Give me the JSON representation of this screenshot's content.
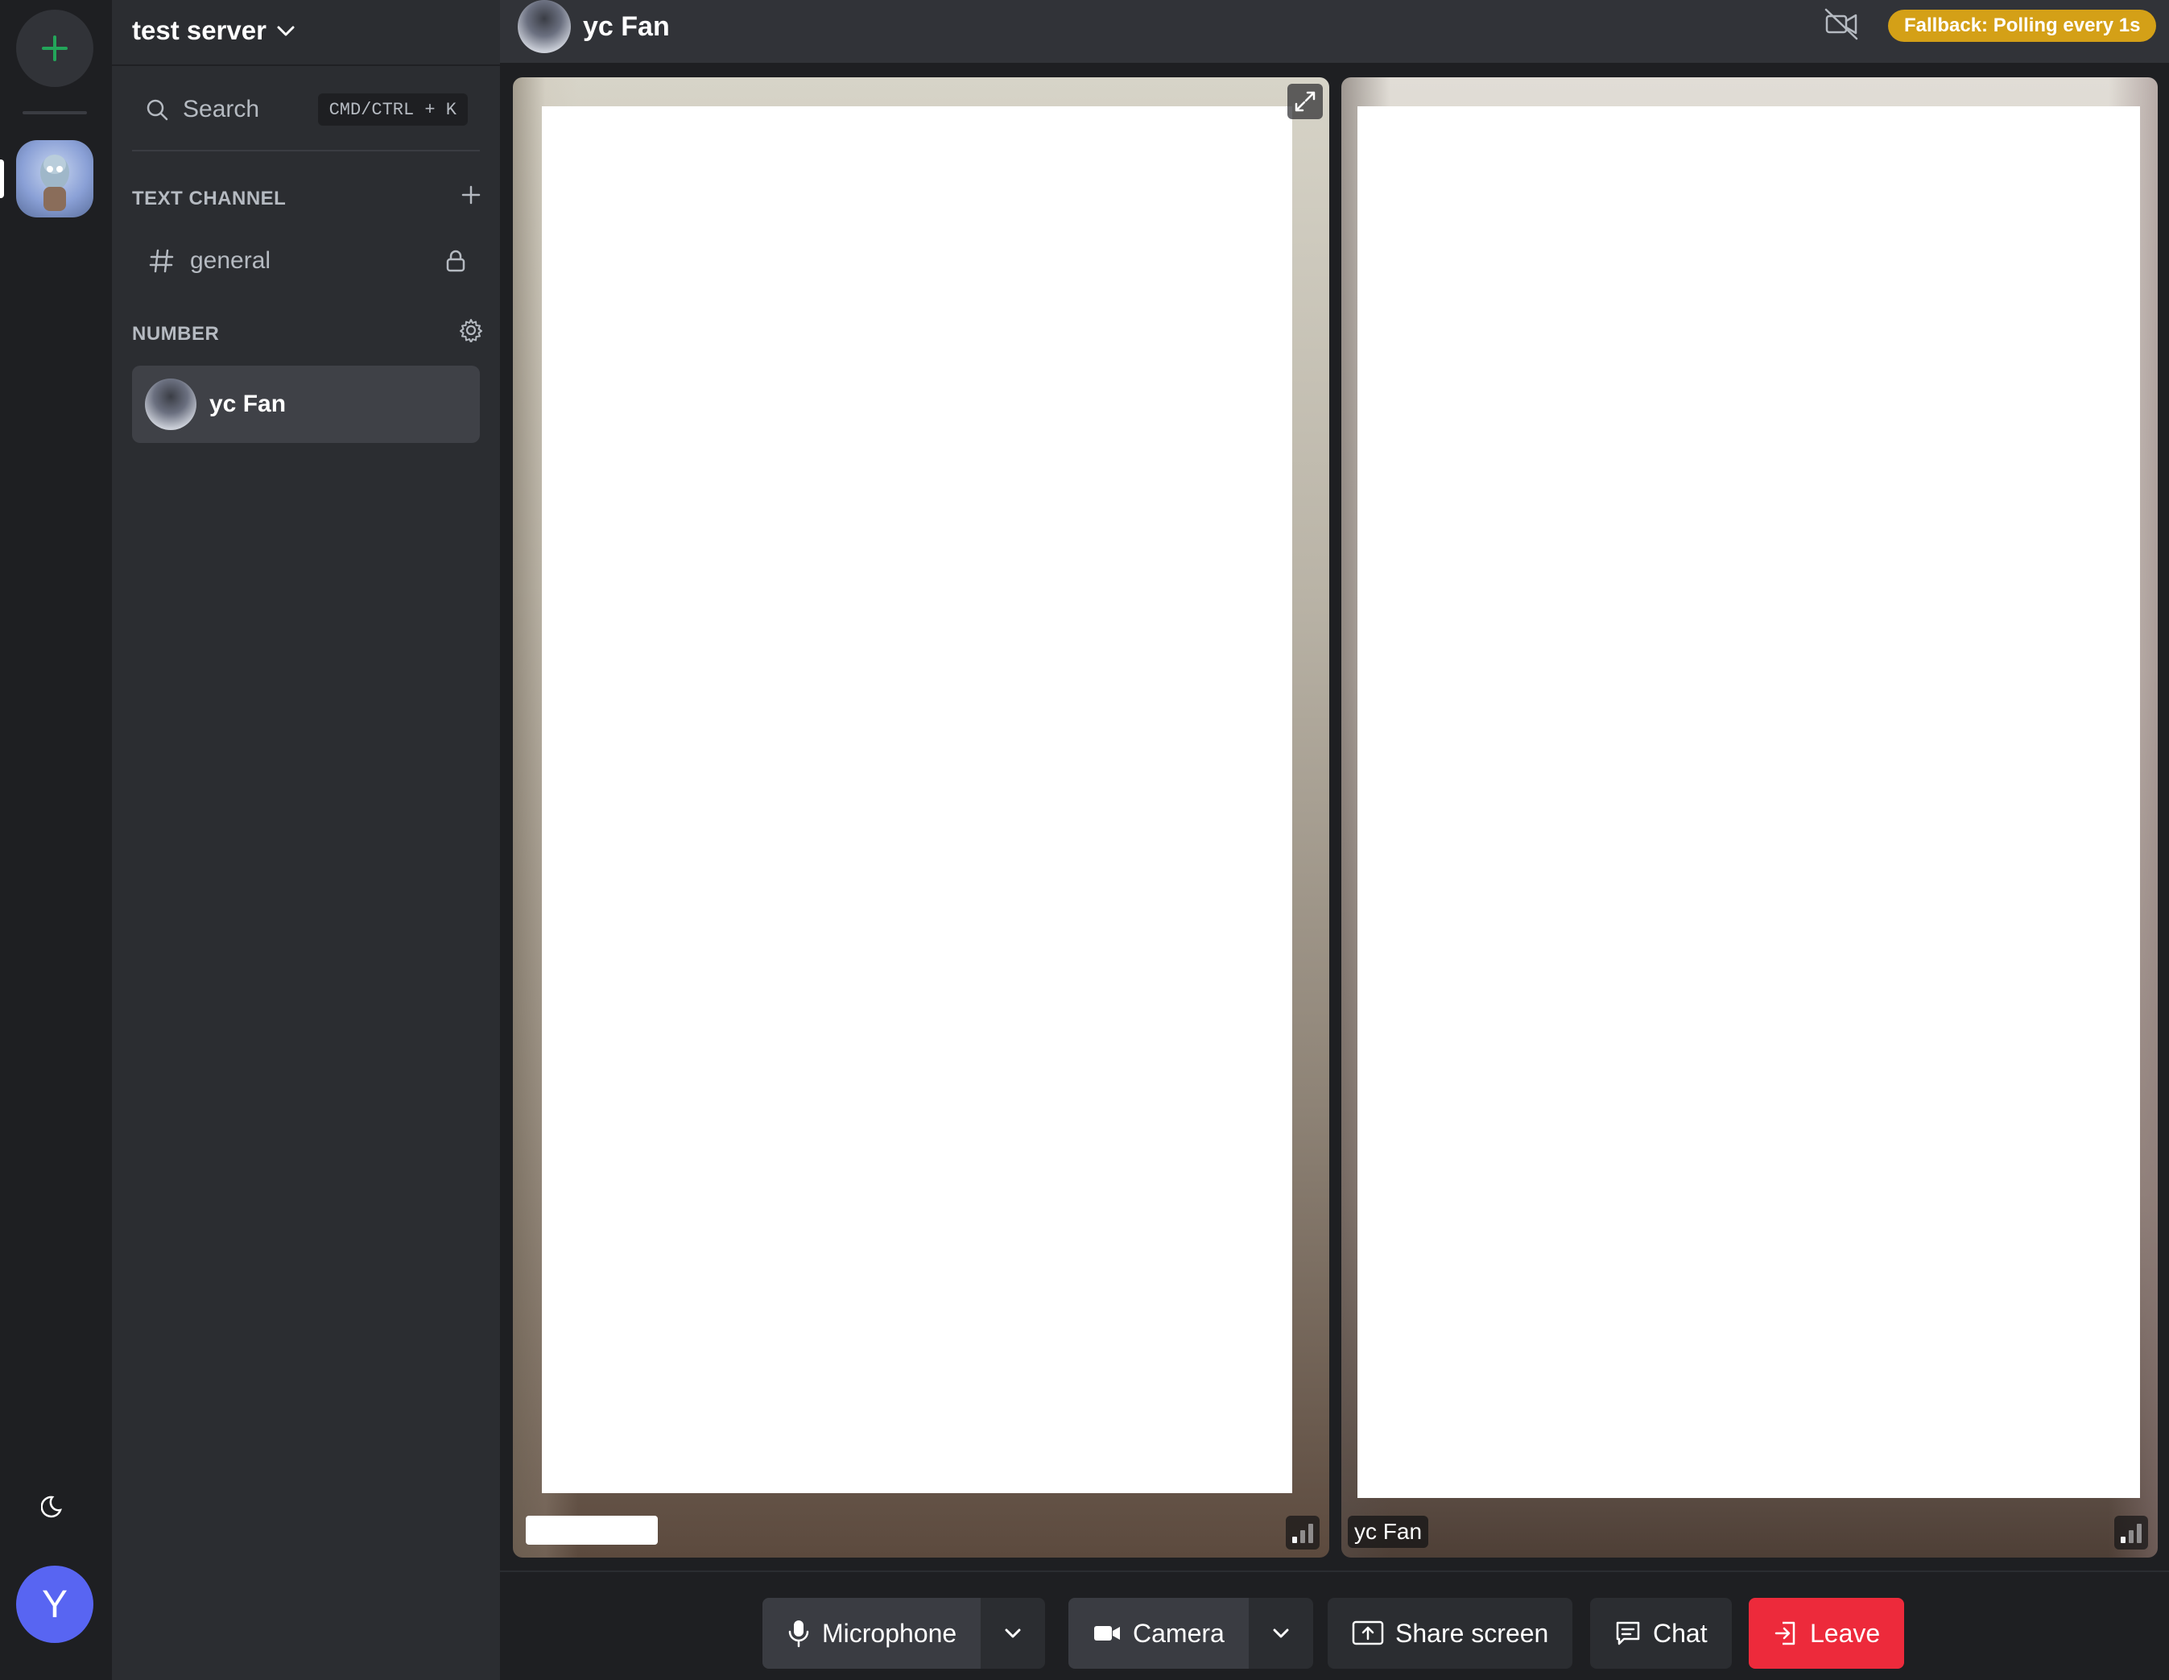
{
  "rail": {
    "add_icon": "plus-icon",
    "theme_icon": "moon-icon",
    "user_initial": "Y",
    "accent": "#23a55a",
    "avatar_color": "#5865f2"
  },
  "sidebar": {
    "server_name": "test server",
    "search": {
      "label": "Search",
      "shortcut": "CMD/CTRL + K"
    },
    "text_section": {
      "title": "TEXT CHANNEL",
      "channels": [
        {
          "name": "general",
          "locked": true
        }
      ]
    },
    "member_section": {
      "title": "NUMBER",
      "members": [
        {
          "name": "yc Fan"
        }
      ]
    }
  },
  "topbar": {
    "title": "yc Fan",
    "status_badge": "Fallback: Polling every 1s",
    "badge_color": "#d4a017"
  },
  "tiles": [
    {
      "participant": "",
      "redacted": true
    },
    {
      "participant": "yc Fan"
    }
  ],
  "controls": {
    "microphone": "Microphone",
    "camera": "Camera",
    "share_screen": "Share screen",
    "chat": "Chat",
    "leave": "Leave",
    "leave_color": "#ed2a3b"
  }
}
